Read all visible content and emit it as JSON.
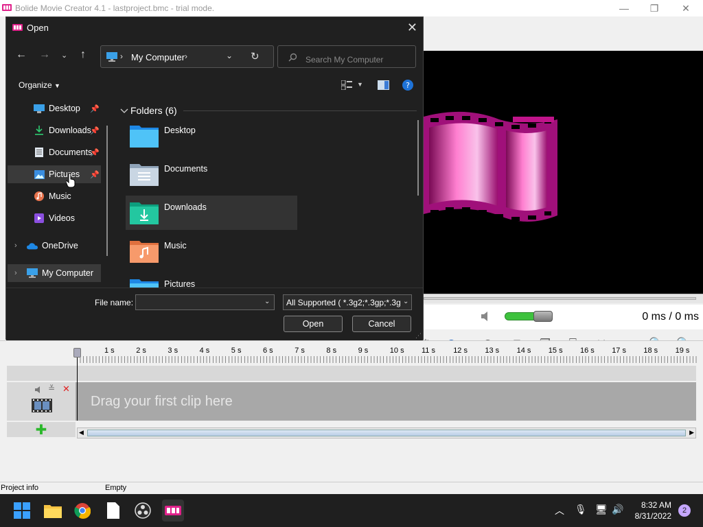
{
  "app": {
    "title": "Bolide Movie Creator 4.1 - lastproject.bmc  - trial mode.",
    "time_display": "0 ms   / 0 ms",
    "drag_hint": "Drag your first clip here",
    "timeline_ticks": [
      "1 s",
      "2 s",
      "3 s",
      "4 s",
      "5 s",
      "6 s",
      "7 s",
      "8 s",
      "9 s",
      "10 s",
      "11 s",
      "12 s",
      "13 s",
      "14 s",
      "15 s",
      "16 s",
      "17 s",
      "18 s",
      "19 s"
    ],
    "status": {
      "project_info": "Project info",
      "state": "Empty"
    },
    "accent": "#e0218a"
  },
  "dialog": {
    "title": "Open",
    "address": "My Computer",
    "search_placeholder": "Search My Computer",
    "organize": "Organize",
    "nav_items": [
      {
        "label": "Desktop",
        "icon": "desktop-icon",
        "pinned": true
      },
      {
        "label": "Downloads",
        "icon": "download-icon",
        "pinned": true
      },
      {
        "label": "Documents",
        "icon": "documents-icon",
        "pinned": true
      },
      {
        "label": "Pictures",
        "icon": "pictures-icon",
        "pinned": true
      },
      {
        "label": "Music",
        "icon": "music-icon",
        "pinned": false
      },
      {
        "label": "Videos",
        "icon": "videos-icon",
        "pinned": false
      },
      {
        "label": "OneDrive",
        "icon": "cloud-icon",
        "pinned": false
      },
      {
        "label": "My Computer",
        "icon": "computer-icon",
        "pinned": false
      }
    ],
    "folders_header": "Folders (6)",
    "folders": [
      {
        "name": "Desktop",
        "icon": "desktop-folder-icon"
      },
      {
        "name": "Documents",
        "icon": "documents-folder-icon"
      },
      {
        "name": "Downloads",
        "icon": "downloads-folder-icon"
      },
      {
        "name": "Music",
        "icon": "music-folder-icon"
      },
      {
        "name": "Pictures",
        "icon": "pictures-folder-icon"
      }
    ],
    "file_name_label": "File name:",
    "file_name_value": "",
    "filter": "All Supported  ( *.3g2;*.3gp;*.3g",
    "open_button": "Open",
    "cancel_button": "Cancel"
  },
  "taskbar": {
    "time": "8:32 AM",
    "date": "8/31/2022",
    "notifications": "2"
  }
}
